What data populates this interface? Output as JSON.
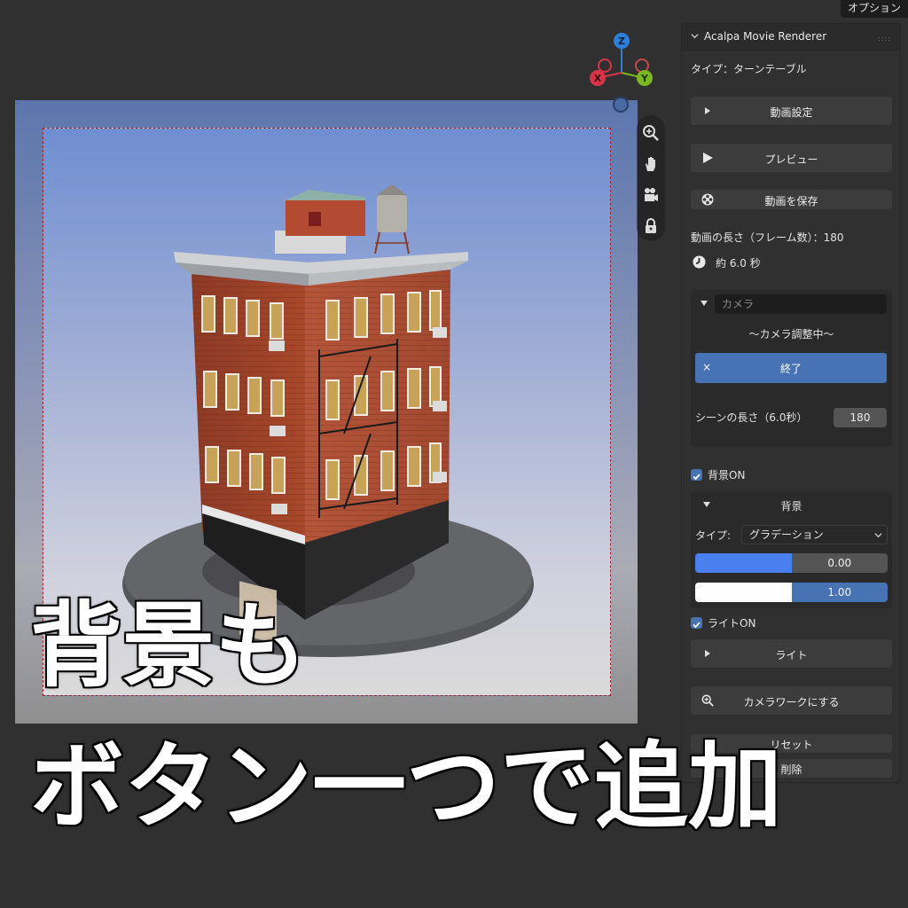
{
  "topbar": {
    "options_label": "オプション"
  },
  "viewport": {
    "gizmo_axes": {
      "z": "Z",
      "x": "X",
      "y": "Y"
    },
    "nav_tools": [
      "zoom-icon",
      "hand-pan-icon",
      "camera-icon",
      "lock-icon"
    ]
  },
  "panel": {
    "title": "Acalpa Movie Renderer",
    "type_line": "タイプ：ターンテーブル",
    "movie_settings_label": "動画設定",
    "preview_label": "プレビュー",
    "save_movie_label": "動画を保存",
    "length_frames": "動画の長さ（フレーム数）：180",
    "length_seconds": "約 6.0 秒",
    "camera": {
      "field_placeholder": "カメラ",
      "status": "〜カメラ調整中〜",
      "end_label": "終了",
      "end_icon": "×",
      "scene_length_label": "シーンの長さ（6.0秒）",
      "scene_length_value": "180"
    },
    "background_on_label": "背景ON",
    "background": {
      "header": "背景",
      "type_label": "タイプ:",
      "type_value": "グラデーション",
      "stops": [
        {
          "color": "#4a7ff0",
          "value": "0.00",
          "fill": 0.5
        },
        {
          "color": "#ffffff",
          "value": "1.00",
          "fill": 0.5
        }
      ]
    },
    "light_on_label": "ライトON",
    "light_label": "ライト",
    "camerawork_label": "カメラワークにする",
    "reset_label": "リセット",
    "delete_label": "削除"
  },
  "caption": {
    "line1": "背景も",
    "line2": "ボタン一つで追加"
  },
  "colors": {
    "accent": "#4772b3",
    "panel_bg": "#303030",
    "viewport_top": "#6f8ed1",
    "viewport_bottom": "#dadada"
  }
}
